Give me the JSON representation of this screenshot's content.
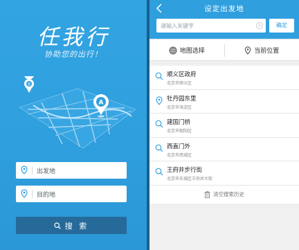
{
  "left_screen": {
    "logo_text": "任我行",
    "slogan": "协助您的出行！",
    "map_pin_a_label": "A",
    "map_pin_b_label": "B",
    "origin_placeholder": "出发地",
    "destination_placeholder": "目的地",
    "search_button_label": "搜 索"
  },
  "right_screen": {
    "title": "设定出发地",
    "back_icon": "chevron-left-icon",
    "search_placeholder": "请输入关键字",
    "confirm_button_label": "确定",
    "actions": [
      {
        "label": "地图选择",
        "icon": "map-grid-icon"
      },
      {
        "label": "当前位置",
        "icon": "location-pin-icon"
      }
    ],
    "results": [
      {
        "name": "顺义区政府",
        "address": "北京市顺义区",
        "icon": "search-icon"
      },
      {
        "name": "牡丹园东里",
        "address": "北京市海淀区",
        "icon": "location-pin-icon"
      },
      {
        "name": "建国门桥",
        "address": "北京市朝阳区",
        "icon": "search-icon"
      },
      {
        "name": "西直门外",
        "address": "北京市西城区",
        "icon": "search-icon"
      },
      {
        "name": "王府井步行街",
        "address": "北京市东城区王府井大街",
        "icon": "search-icon"
      }
    ],
    "clear_history_label": "清空搜索历史"
  },
  "colors": {
    "primary_blue": "#2f9fde",
    "search_button_dark": "#266a9a",
    "list_background": "#f0f0f0"
  }
}
